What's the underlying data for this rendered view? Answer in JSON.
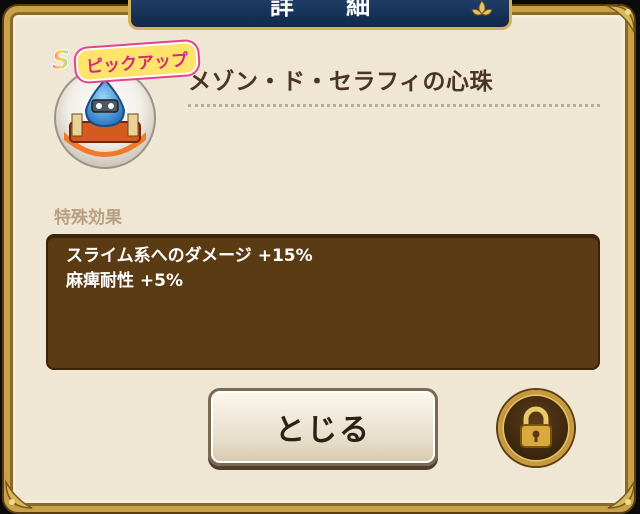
{
  "header": {
    "title": "詳 細"
  },
  "item": {
    "rank": "S",
    "pickup_label": "ピックアップ",
    "name": "メゾン・ド・セラフィの心珠",
    "icon": "slime-orb-icon"
  },
  "effects": {
    "section_label": "特殊効果",
    "lines": [
      "スライム系へのダメージ +15%",
      "麻痺耐性 +5%"
    ]
  },
  "buttons": {
    "close_label": "とじる",
    "lock_icon": "lock-icon"
  },
  "colors": {
    "frame_gold": "#c7a24a",
    "panel_bg": "#efe6d4",
    "title_bar": "#1f3d66",
    "effect_box": "#5a3b14",
    "text_brown": "#4a3520"
  }
}
